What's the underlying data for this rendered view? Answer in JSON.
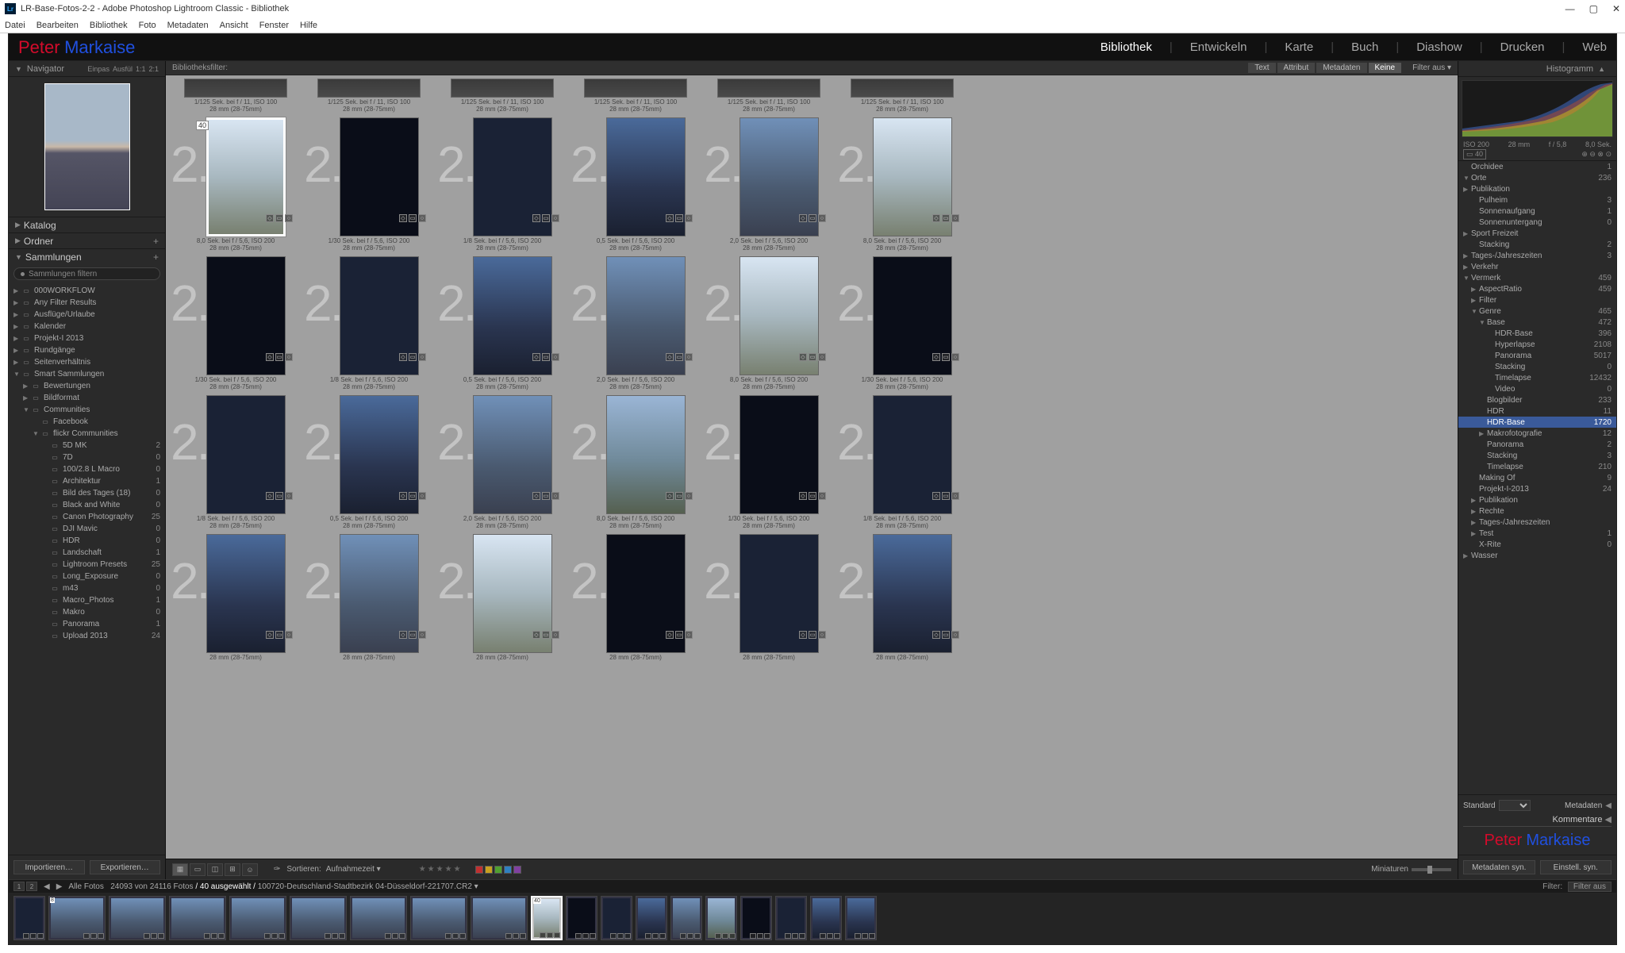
{
  "window": {
    "title": "LR-Base-Fotos-2-2 - Adobe Photoshop Lightroom Classic - Bibliothek",
    "app_badge": "Lr"
  },
  "menu": [
    "Datei",
    "Bearbeiten",
    "Bibliothek",
    "Foto",
    "Metadaten",
    "Ansicht",
    "Fenster",
    "Hilfe"
  ],
  "brand": {
    "first": "Peter",
    "last": "Markaise"
  },
  "modules": [
    "Bibliothek",
    "Entwickeln",
    "Karte",
    "Buch",
    "Diashow",
    "Drucken",
    "Web"
  ],
  "modules_active": "Bibliothek",
  "left": {
    "navigator": {
      "title": "Navigator",
      "modes": [
        "Einpas",
        "Ausfül",
        "1:1",
        "2:1"
      ]
    },
    "sections": {
      "katalog": "Katalog",
      "ordner": "Ordner",
      "sammlungen": "Sammlungen"
    },
    "filter_placeholder": "Sammlungen filtern",
    "tree": [
      {
        "indent": 0,
        "caret": "▶",
        "label": "000WORKFLOW",
        "count": ""
      },
      {
        "indent": 0,
        "caret": "▶",
        "label": "Any Filter Results",
        "count": ""
      },
      {
        "indent": 0,
        "caret": "▶",
        "label": "Ausflüge/Urlaube",
        "count": ""
      },
      {
        "indent": 0,
        "caret": "▶",
        "label": "Kalender",
        "count": ""
      },
      {
        "indent": 0,
        "caret": "▶",
        "label": "Projekt-I 2013",
        "count": ""
      },
      {
        "indent": 0,
        "caret": "▶",
        "label": "Rundgänge",
        "count": ""
      },
      {
        "indent": 0,
        "caret": "▶",
        "label": "Seitenverhältnis",
        "count": ""
      },
      {
        "indent": 0,
        "caret": "▼",
        "label": "Smart Sammlungen",
        "count": ""
      },
      {
        "indent": 1,
        "caret": "▶",
        "label": "Bewertungen",
        "count": ""
      },
      {
        "indent": 1,
        "caret": "▶",
        "label": "Bildformat",
        "count": ""
      },
      {
        "indent": 1,
        "caret": "▼",
        "label": "Communities",
        "count": ""
      },
      {
        "indent": 2,
        "caret": "",
        "label": "Facebook",
        "count": ""
      },
      {
        "indent": 2,
        "caret": "▼",
        "label": "flickr Communities",
        "count": ""
      },
      {
        "indent": 3,
        "caret": "",
        "label": "5D MK",
        "count": "2"
      },
      {
        "indent": 3,
        "caret": "",
        "label": "7D",
        "count": "0"
      },
      {
        "indent": 3,
        "caret": "",
        "label": "100/2.8 L Macro",
        "count": "0"
      },
      {
        "indent": 3,
        "caret": "",
        "label": "Architektur",
        "count": "1"
      },
      {
        "indent": 3,
        "caret": "",
        "label": "Bild des Tages (18)",
        "count": "0"
      },
      {
        "indent": 3,
        "caret": "",
        "label": "Black and White",
        "count": "0"
      },
      {
        "indent": 3,
        "caret": "",
        "label": "Canon Photography",
        "count": "25"
      },
      {
        "indent": 3,
        "caret": "",
        "label": "DJI Mavic",
        "count": "0"
      },
      {
        "indent": 3,
        "caret": "",
        "label": "HDR",
        "count": "0"
      },
      {
        "indent": 3,
        "caret": "",
        "label": "Landschaft",
        "count": "1"
      },
      {
        "indent": 3,
        "caret": "",
        "label": "Lightroom Presets",
        "count": "25"
      },
      {
        "indent": 3,
        "caret": "",
        "label": "Long_Exposure",
        "count": "0"
      },
      {
        "indent": 3,
        "caret": "",
        "label": "m43",
        "count": "0"
      },
      {
        "indent": 3,
        "caret": "",
        "label": "Macro_Photos",
        "count": "1"
      },
      {
        "indent": 3,
        "caret": "",
        "label": "Makro",
        "count": "0"
      },
      {
        "indent": 3,
        "caret": "",
        "label": "Panorama",
        "count": "1"
      },
      {
        "indent": 3,
        "caret": "",
        "label": "Upload 2013",
        "count": "24"
      }
    ],
    "buttons": {
      "import": "Importieren…",
      "export": "Exportieren…"
    }
  },
  "filter_bar": {
    "label": "Bibliotheksfilter:",
    "tabs": [
      "Text",
      "Attribut",
      "Metadaten",
      "Keine"
    ],
    "active": "Keine",
    "dropdown": "Filter aus ▾"
  },
  "grid": {
    "partial_row": [
      {
        "meta1": "1/125 Sek. bei f / 11, ISO 100",
        "meta2": "28 mm (28-75mm)",
        "b": "b-part"
      },
      {
        "meta1": "1/125 Sek. bei f / 11, ISO 100",
        "meta2": "28 mm (28-75mm)",
        "b": "b-part"
      },
      {
        "meta1": "1/125 Sek. bei f / 11, ISO 100",
        "meta2": "28 mm (28-75mm)",
        "b": "b-part"
      },
      {
        "meta1": "1/125 Sek. bei f / 11, ISO 100",
        "meta2": "28 mm (28-75mm)",
        "b": "b-part"
      },
      {
        "meta1": "1/125 Sek. bei f / 11, ISO 100",
        "meta2": "28 mm (28-75mm)",
        "b": "b-part"
      },
      {
        "meta1": "1/125 Sek. bei f / 11, ISO 100",
        "meta2": "28 mm (28-75mm)",
        "b": "b-part"
      }
    ],
    "rows": [
      [
        {
          "selected": true,
          "badge": "40",
          "meta1": "8,0 Sek. bei f / 5,6, ISO 200",
          "meta2": "28 mm (28-75mm)",
          "b": "b-bright"
        },
        {
          "meta1": "1/30 Sek. bei f / 5,6, ISO 200",
          "meta2": "28 mm (28-75mm)",
          "b": "b-vdark"
        },
        {
          "meta1": "1/8 Sek. bei f / 5,6, ISO 200",
          "meta2": "28 mm (28-75mm)",
          "b": "b-dark"
        },
        {
          "meta1": "0,5 Sek. bei f / 5,6, ISO 200",
          "meta2": "28 mm (28-75mm)",
          "b": "b-dusk"
        },
        {
          "meta1": "2,0 Sek. bei f / 5,6, ISO 200",
          "meta2": "28 mm (28-75mm)",
          "b": "b-eve"
        },
        {
          "meta1": "8,0 Sek. bei f / 5,6, ISO 200",
          "meta2": "28 mm (28-75mm)",
          "b": "b-bright"
        }
      ],
      [
        {
          "meta1": "1/30 Sek. bei f / 5,6, ISO 200",
          "meta2": "28 mm (28-75mm)",
          "b": "b-vdark"
        },
        {
          "meta1": "1/8 Sek. bei f / 5,6, ISO 200",
          "meta2": "28 mm (28-75mm)",
          "b": "b-dark"
        },
        {
          "meta1": "0,5 Sek. bei f / 5,6, ISO 200",
          "meta2": "28 mm (28-75mm)",
          "b": "b-dusk"
        },
        {
          "meta1": "2,0 Sek. bei f / 5,6, ISO 200",
          "meta2": "28 mm (28-75mm)",
          "b": "b-eve"
        },
        {
          "meta1": "8,0 Sek. bei f / 5,6, ISO 200",
          "meta2": "28 mm (28-75mm)",
          "b": "b-bright"
        },
        {
          "meta1": "1/30 Sek. bei f / 5,6, ISO 200",
          "meta2": "28 mm (28-75mm)",
          "b": "b-vdark"
        }
      ],
      [
        {
          "meta1": "1/8 Sek. bei f / 5,6, ISO 200",
          "meta2": "28 mm (28-75mm)",
          "b": "b-dark"
        },
        {
          "meta1": "0,5 Sek. bei f / 5,6, ISO 200",
          "meta2": "28 mm (28-75mm)",
          "b": "b-dusk"
        },
        {
          "meta1": "2,0 Sek. bei f / 5,6, ISO 200",
          "meta2": "28 mm (28-75mm)",
          "b": "b-eve"
        },
        {
          "meta1": "8,0 Sek. bei f / 5,6, ISO 200",
          "meta2": "28 mm (28-75mm)",
          "b": "b-day"
        },
        {
          "meta1": "1/30 Sek. bei f / 5,6, ISO 200",
          "meta2": "28 mm (28-75mm)",
          "b": "b-vdark"
        },
        {
          "meta1": "1/8 Sek. bei f / 5,6, ISO 200",
          "meta2": "28 mm (28-75mm)",
          "b": "b-dark"
        }
      ],
      [
        {
          "meta1": "",
          "meta2": "28 mm (28-75mm)",
          "b": "b-dusk"
        },
        {
          "meta1": "",
          "meta2": "28 mm (28-75mm)",
          "b": "b-eve"
        },
        {
          "meta1": "",
          "meta2": "28 mm (28-75mm)",
          "b": "b-bright"
        },
        {
          "meta1": "",
          "meta2": "28 mm (28-75mm)",
          "b": "b-vdark"
        },
        {
          "meta1": "",
          "meta2": "28 mm (28-75mm)",
          "b": "b-dark"
        },
        {
          "meta1": "",
          "meta2": "28 mm (28-75mm)",
          "b": "b-dusk"
        }
      ]
    ],
    "bignum_prefix": "2."
  },
  "toolbar": {
    "sort_label": "Sortieren:",
    "sort_value": "Aufnahmezeit ▾",
    "thumb_label": "Miniaturen",
    "colors": [
      "#c03030",
      "#c8a020",
      "#50a030",
      "#3080c0",
      "#8040a0"
    ]
  },
  "right": {
    "histogram_title": "Histogramm",
    "histo_labels": [
      "ISO 200",
      "28 mm",
      "f / 5,8",
      "8,0 Sek."
    ],
    "histo_info": {
      "badge": "40"
    },
    "keywords": [
      {
        "indent": 0,
        "caret": "",
        "label": "Orchidee",
        "count": "1"
      },
      {
        "indent": 0,
        "caret": "▼",
        "label": "Orte",
        "count": "236"
      },
      {
        "indent": 0,
        "caret": "▶",
        "label": "Publikation",
        "count": ""
      },
      {
        "indent": 1,
        "caret": "",
        "label": "Pulheim",
        "count": "3"
      },
      {
        "indent": 1,
        "caret": "",
        "label": "Sonnenaufgang",
        "count": "1"
      },
      {
        "indent": 1,
        "caret": "",
        "label": "Sonnenuntergang",
        "count": "0"
      },
      {
        "indent": 0,
        "caret": "▶",
        "label": "Sport Freizeit",
        "count": ""
      },
      {
        "indent": 1,
        "caret": "",
        "label": "Stacking",
        "count": "2"
      },
      {
        "indent": 0,
        "caret": "▶",
        "label": "Tages-/Jahreszeiten",
        "count": "3"
      },
      {
        "indent": 0,
        "caret": "▶",
        "label": "Verkehr",
        "count": ""
      },
      {
        "indent": 0,
        "caret": "▼",
        "label": "Vermerk",
        "count": "459"
      },
      {
        "indent": 1,
        "caret": "▶",
        "label": "AspectRatio",
        "count": "459"
      },
      {
        "indent": 1,
        "caret": "▶",
        "label": "Filter",
        "count": ""
      },
      {
        "indent": 1,
        "caret": "▼",
        "label": "Genre",
        "count": "465"
      },
      {
        "indent": 2,
        "caret": "▼",
        "label": "Base",
        "count": "472"
      },
      {
        "indent": 3,
        "caret": "",
        "label": "HDR-Base",
        "count": "396"
      },
      {
        "indent": 3,
        "caret": "",
        "label": "Hyperlapse",
        "count": "2108"
      },
      {
        "indent": 3,
        "caret": "",
        "label": "Panorama",
        "count": "5017"
      },
      {
        "indent": 3,
        "caret": "",
        "label": "Stacking",
        "count": "0"
      },
      {
        "indent": 3,
        "caret": "",
        "label": "Timelapse",
        "count": "12432"
      },
      {
        "indent": 3,
        "caret": "",
        "label": "Video",
        "count": "0"
      },
      {
        "indent": 2,
        "caret": "",
        "label": "Blogbilder",
        "count": "233"
      },
      {
        "indent": 2,
        "caret": "",
        "label": "HDR",
        "count": "11"
      },
      {
        "indent": 2,
        "caret": "",
        "label": "HDR-Base",
        "count": "1720",
        "sel": true
      },
      {
        "indent": 2,
        "caret": "▶",
        "label": "Makrofotografie",
        "count": "12"
      },
      {
        "indent": 2,
        "caret": "",
        "label": "Panorama",
        "count": "2"
      },
      {
        "indent": 2,
        "caret": "",
        "label": "Stacking",
        "count": "3"
      },
      {
        "indent": 2,
        "caret": "",
        "label": "Timelapse",
        "count": "210"
      },
      {
        "indent": 1,
        "caret": "",
        "label": "Making Of",
        "count": "9"
      },
      {
        "indent": 1,
        "caret": "",
        "label": "Projekt-I-2013",
        "count": "24"
      },
      {
        "indent": 1,
        "caret": "▶",
        "label": "Publikation",
        "count": ""
      },
      {
        "indent": 1,
        "caret": "▶",
        "label": "Rechte",
        "count": ""
      },
      {
        "indent": 1,
        "caret": "▶",
        "label": "Tages-/Jahreszeiten",
        "count": ""
      },
      {
        "indent": 1,
        "caret": "▶",
        "label": "Test",
        "count": "1"
      },
      {
        "indent": 1,
        "caret": "",
        "label": "X-Rite",
        "count": "0"
      },
      {
        "indent": 0,
        "caret": "▶",
        "label": "Wasser",
        "count": ""
      }
    ],
    "standard_label": "Standard",
    "metadata_head": "Metadaten",
    "comments_head": "Kommentare",
    "sync_meta": "Metadaten syn.",
    "sync_settings": "Einstell. syn."
  },
  "filmstrip": {
    "path_prefix": "Alle Fotos",
    "count_text": "24093 von 24116 Fotos",
    "selected_text": "/ 40 ausgewählt /",
    "filename": "100720-Deutschland-Stadtbezirk 04-Düsseldorf-221707.CR2",
    "filter_label": "Filter:",
    "filter_value": "Filter aus",
    "thumbs": [
      {
        "b": "b-dark",
        "portrait": true
      },
      {
        "b": "b-eve",
        "badge": "8"
      },
      {
        "b": "b-eve"
      },
      {
        "b": "b-eve"
      },
      {
        "b": "b-eve"
      },
      {
        "b": "b-eve"
      },
      {
        "b": "b-eve"
      },
      {
        "b": "b-eve"
      },
      {
        "b": "b-eve"
      },
      {
        "b": "b-bright",
        "portrait": true,
        "sel": true,
        "badge": "40"
      },
      {
        "b": "b-vdark",
        "portrait": true
      },
      {
        "b": "b-dark",
        "portrait": true
      },
      {
        "b": "b-dusk",
        "portrait": true
      },
      {
        "b": "b-eve",
        "portrait": true
      },
      {
        "b": "b-day",
        "portrait": true
      },
      {
        "b": "b-vdark",
        "portrait": true
      },
      {
        "b": "b-dark",
        "portrait": true
      },
      {
        "b": "b-dusk",
        "portrait": true
      },
      {
        "b": "b-dusk",
        "portrait": true
      }
    ]
  }
}
